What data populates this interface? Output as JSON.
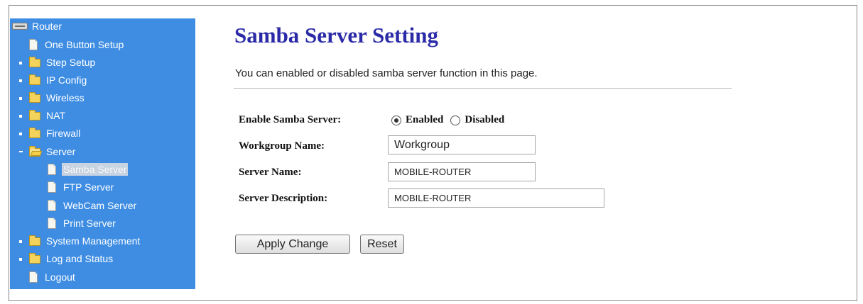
{
  "sidebar": {
    "root_label": "Router",
    "items": {
      "one_button_setup": "One Button Setup",
      "step_setup": "Step Setup",
      "ip_config": "IP Config",
      "wireless": "Wireless",
      "nat": "NAT",
      "firewall": "Firewall",
      "server": "Server",
      "samba_server": "Samba Server",
      "ftp_server": "FTP Server",
      "webcam_server": "WebCam Server",
      "print_server": "Print Server",
      "system_management": "System Management",
      "log_and_status": "Log and Status",
      "logout": "Logout"
    },
    "selected_item": "Samba Server",
    "background_color": "#3e8de3"
  },
  "page": {
    "title": "Samba Server Setting",
    "description": "You can enabled or disabled samba server function in this page.",
    "title_color": "#2b2ba8"
  },
  "form": {
    "enable_label": "Enable Samba Server:",
    "enabled_option": "Enabled",
    "disabled_option": "Disabled",
    "selected_option": "Enabled",
    "workgroup_label": "Workgroup Name:",
    "workgroup_value": "Workgroup",
    "server_name_label": "Server Name:",
    "server_name_value": "MOBILE-ROUTER",
    "server_description_label": "Server Description:",
    "server_description_value": "MOBILE-ROUTER"
  },
  "buttons": {
    "apply": "Apply Change",
    "reset": "Reset"
  }
}
